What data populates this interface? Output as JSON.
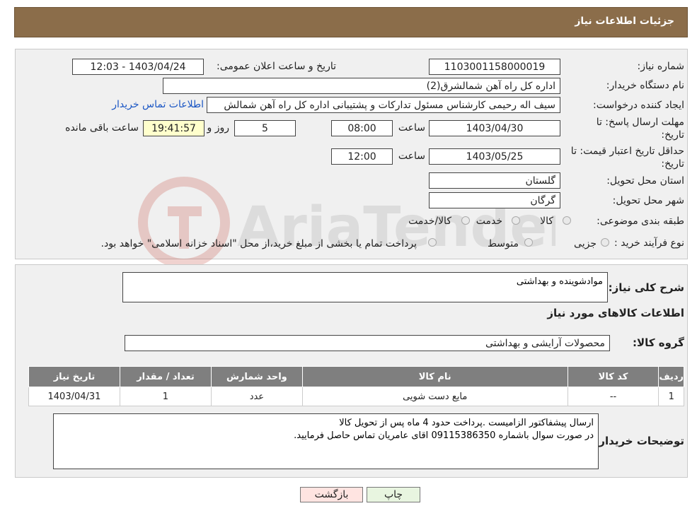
{
  "header": {
    "title": "جزئیات اطلاعات نیاز"
  },
  "form": {
    "need_number": {
      "label": "شماره نیاز:",
      "value": "1103001158000019"
    },
    "announce_datetime": {
      "label": "تاریخ و ساعت اعلان عمومی:",
      "value": "1403/04/24 - 12:03"
    },
    "buyer_org": {
      "label": "نام دستگاه خریدار:",
      "value": "اداره کل راه آهن شمالشرق(2)"
    },
    "requester": {
      "label": "ایجاد کننده درخواست:",
      "value": "سیف اله رحیمی کارشناس مسئول تدارکات و پشتیبانی اداره کل راه آهن شمالش",
      "contact_link": "اطلاعات تماس خریدار"
    },
    "reply_deadline": {
      "label_line1": "مهلت ارسال پاسخ: تا",
      "label_line2": "تاریخ:",
      "date": "1403/04/30",
      "time_label": "ساعت",
      "time": "08:00",
      "days": "5",
      "days_label": "روز و",
      "remaining_time": "19:41:57",
      "remaining_label": "ساعت باقی مانده"
    },
    "price_validity": {
      "label_line1": "حداقل تاریخ اعتبار قیمت: تا",
      "label_line2": "تاریخ:",
      "date": "1403/05/25",
      "time_label": "ساعت",
      "time": "12:00"
    },
    "province": {
      "label": "استان محل تحویل:",
      "value": "گلستان"
    },
    "city": {
      "label": "شهر محل تحویل:",
      "value": "گرگان"
    },
    "category": {
      "label": "طبقه بندی موضوعی:",
      "options": [
        "کالا",
        "خدمت",
        "کالا/خدمت"
      ]
    },
    "process": {
      "label": "نوع فرآیند خرید :",
      "options": [
        "جزیی",
        "متوسط"
      ],
      "note": "پرداخت تمام یا بخشی از مبلغ خرید،از محل \"اسناد خزانه اسلامی\" خواهد بود."
    }
  },
  "details": {
    "general_desc": {
      "label": "شرح کلی نیاز:",
      "value": "موادشوینده و بهداشتی"
    },
    "goods_section_title": "اطلاعات کالاهای مورد نیاز",
    "goods_group": {
      "label": "گروه کالا:",
      "value": "محصولات آرایشی و بهداشتی"
    },
    "table": {
      "headers": [
        "ردیف",
        "کد کالا",
        "نام کالا",
        "واحد شمارش",
        "تعداد / مقدار",
        "تاریخ نیاز"
      ],
      "rows": [
        [
          "1",
          "--",
          "مایع دست شویی",
          "عدد",
          "1",
          "1403/04/31"
        ]
      ]
    },
    "buyer_notes": {
      "label": "توضیحات خریدار:",
      "value": "ارسال پیشفاکتور الزامیست .پرداخت حدود 4 ماه پس از تحویل کالا\nدر صورت سوال باشماره 09115386350 اقای عامریان تماس حاصل فرمایید."
    }
  },
  "buttons": {
    "print": "چاپ",
    "back": "بازگشت"
  },
  "colors": {
    "header_bg": "#8b6d4a",
    "panel_bg": "#f0f0f0",
    "table_header_bg": "#7f7f7f",
    "back_button_bg": "#ffe4e1",
    "print_button_bg": "#e8f5e0",
    "link": "#1a56c4"
  },
  "watermark": {
    "text": "AriaTender.neT"
  }
}
